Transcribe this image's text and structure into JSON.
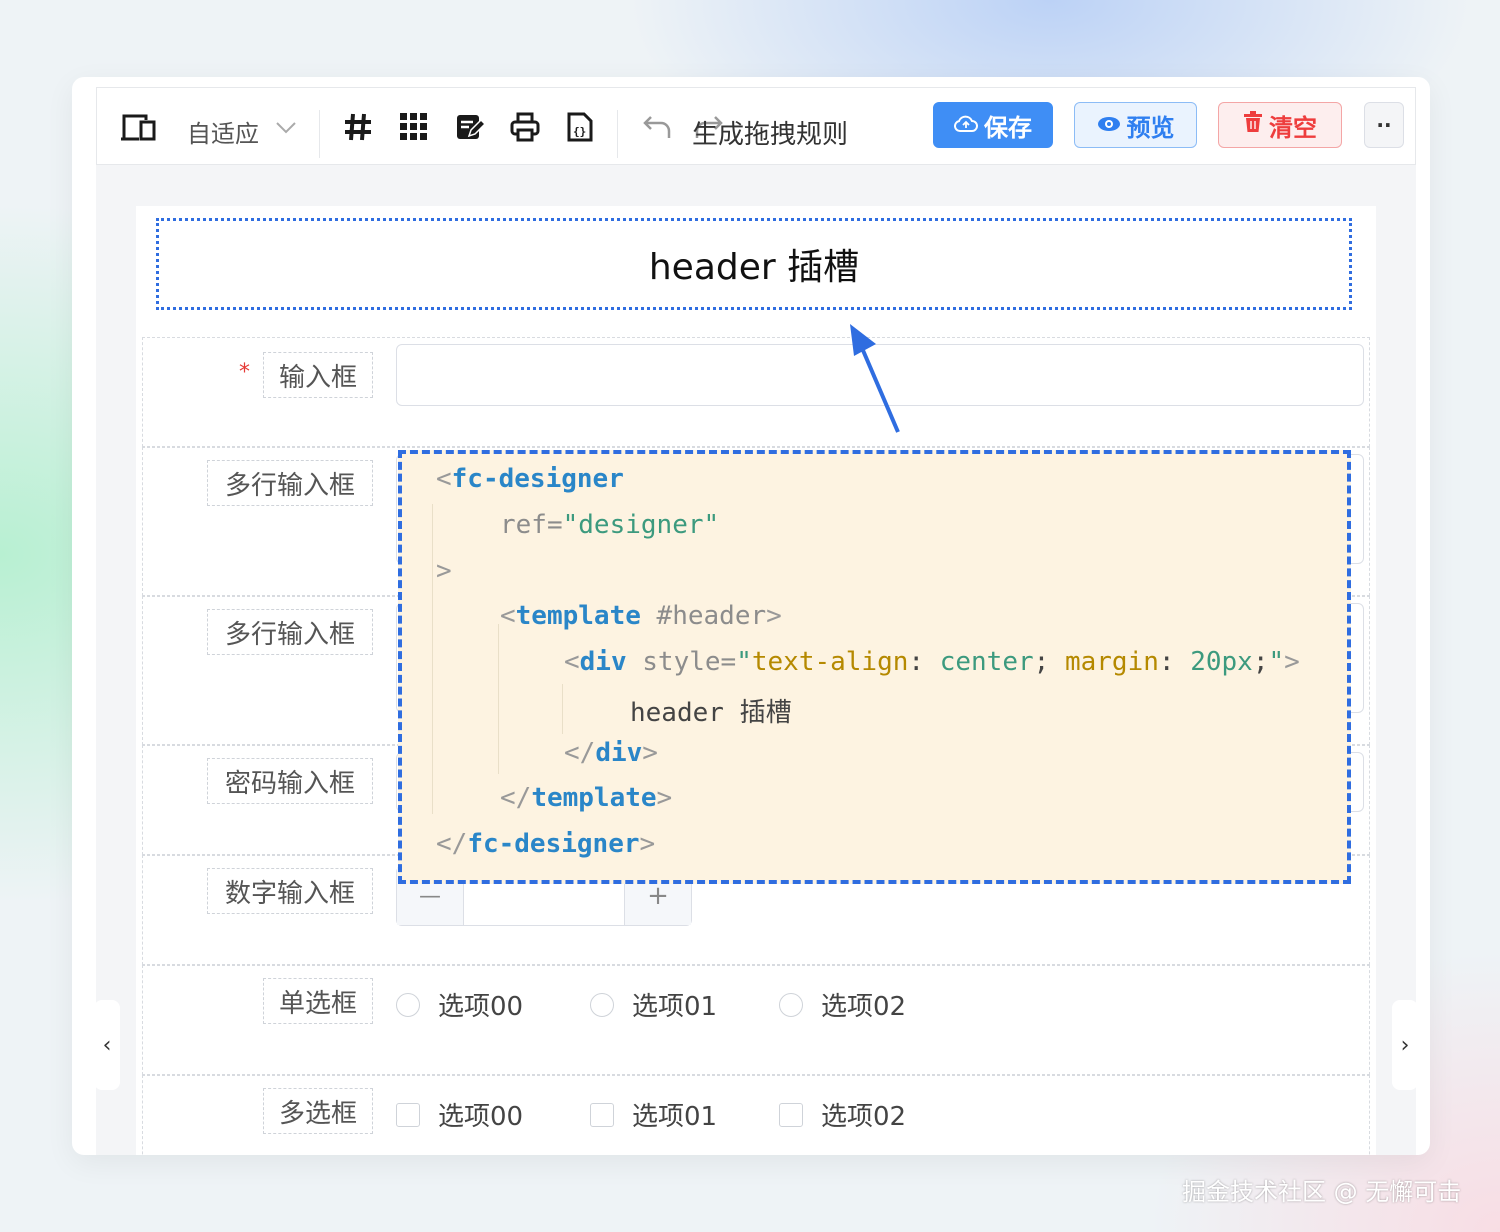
{
  "toolbar": {
    "device_select": "自适应",
    "title_rule": "生成拖拽规则",
    "save_label": "保存",
    "preview_label": "预览",
    "clear_label": "清空",
    "more_label": "··"
  },
  "header_slot": {
    "text": "header 插槽"
  },
  "form": {
    "input": {
      "label": "输入框",
      "required_mark": "*"
    },
    "textarea1": {
      "label": "多行输入框"
    },
    "textarea2": {
      "label": "多行输入框"
    },
    "password": {
      "label": "密码输入框"
    },
    "number": {
      "label": "数字输入框",
      "minus": "—",
      "plus": "+"
    },
    "radio": {
      "label": "单选框",
      "options": [
        "选项00",
        "选项01",
        "选项02"
      ]
    },
    "checkbox": {
      "label": "多选框",
      "options": [
        "选项00",
        "选项01",
        "选项02"
      ]
    }
  },
  "code": {
    "l1_tag": "fc-designer",
    "l2_attr": "ref=",
    "l2_val": "\"designer\"",
    "l3": ">",
    "l4_tag": "template",
    "l4_attr": "#header",
    "l5_tag": "div",
    "l5_attr": "style=",
    "l5_q1": "\"",
    "l5_p1": "text-align",
    "l5_c1": ": ",
    "l5_v1": "center",
    "l5_s1": "; ",
    "l5_p2": "margin",
    "l5_c2": ": ",
    "l5_v2": "20px",
    "l5_s2": ";",
    "l5_q2": "\"",
    "l6_text": "header 插槽",
    "l7_tag": "div",
    "l8_tag": "template",
    "l9_tag": "fc-designer"
  },
  "nav": {
    "prev": "‹",
    "next": "›"
  },
  "watermark": "掘金技术社区 @ 无懈可击",
  "colors": {
    "accent": "#3f8ef5",
    "danger": "#ee3d3d",
    "slot_border": "#2f6de0",
    "code_bg": "#fdf3e1"
  }
}
